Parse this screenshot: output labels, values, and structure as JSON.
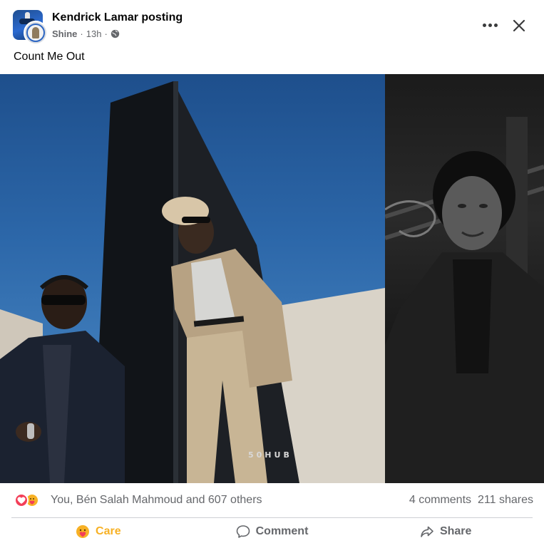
{
  "post": {
    "group_name": "Kendrick Lamar posting",
    "author": "Shine",
    "time": "13h",
    "separator": "·",
    "caption": "Count Me Out"
  },
  "media": {
    "watermark": "50HUB"
  },
  "reactions": {
    "summary": "You, Bén Salah Mahmoud and 607 others",
    "icons": [
      "love-reaction",
      "care-reaction"
    ],
    "comments": "4 comments",
    "shares": "211 shares"
  },
  "actions": {
    "care": "Care",
    "comment": "Comment",
    "share": "Share"
  },
  "colors": {
    "care_active": "#f7b125",
    "secondary_text": "#65676b",
    "love": "#f33e58"
  }
}
